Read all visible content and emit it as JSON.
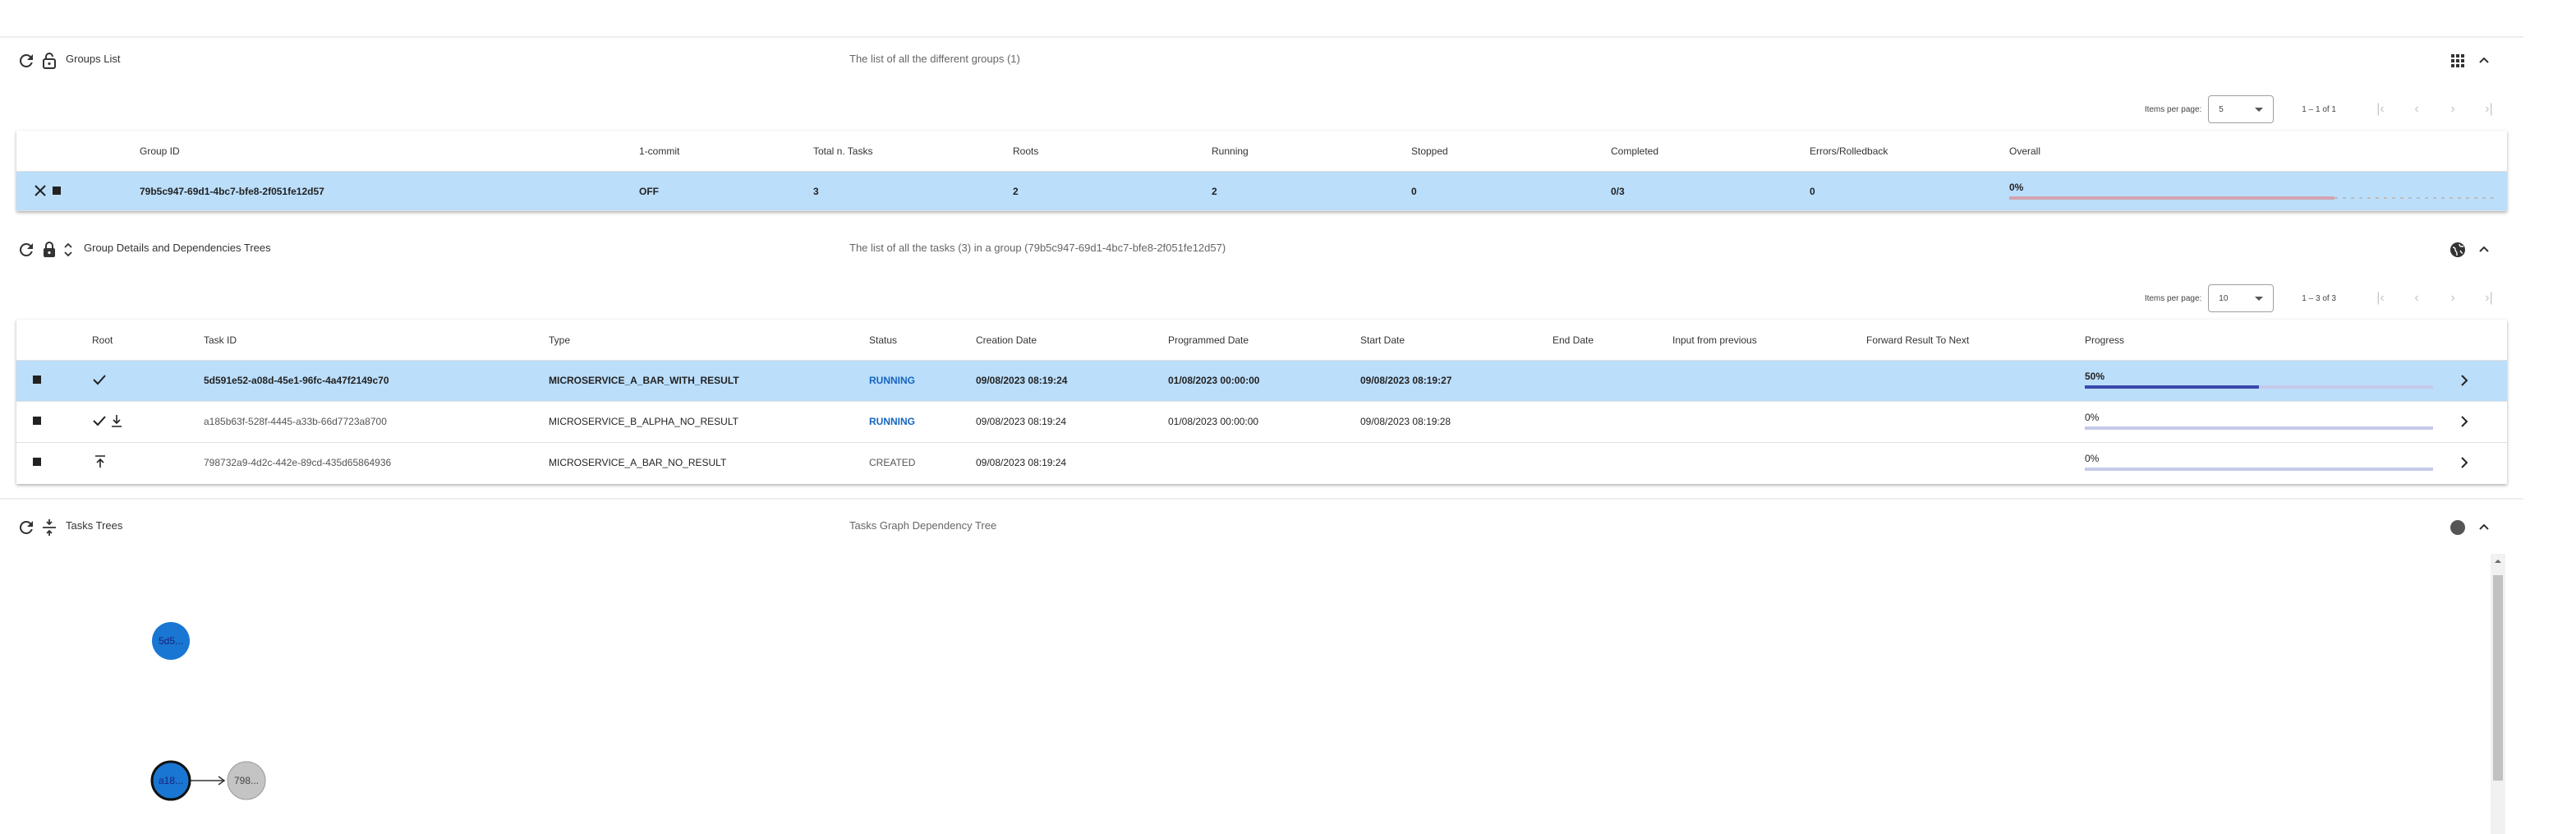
{
  "groups_panel": {
    "title": "Groups List",
    "description": "The list of all the different groups (1)",
    "items_per_page_label": "Items per page:",
    "items_per_page": "5",
    "range": "1 – 1 of 1",
    "columns": [
      "Group ID",
      "1-commit",
      "Total n. Tasks",
      "Roots",
      "Running",
      "Stopped",
      "Completed",
      "Errors/Rolledback",
      "Overall"
    ],
    "row": {
      "group_id": "79b5c947-69d1-4bc7-bfe8-2f051fe12d57",
      "one_commit": "OFF",
      "total_tasks": "3",
      "roots": "2",
      "running": "2",
      "stopped": "0",
      "completed": "0/3",
      "errors": "0",
      "overall": "0%",
      "overall_progress": 0
    }
  },
  "details_panel": {
    "title": "Group Details and Dependencies Trees",
    "description": "The list of all the tasks (3) in a group (79b5c947-69d1-4bc7-bfe8-2f051fe12d57)",
    "items_per_page_label": "Items per page:",
    "items_per_page": "10",
    "range": "1 – 3 of 3",
    "columns": [
      "Root",
      "Task ID",
      "Type",
      "Status",
      "Creation Date",
      "Programmed Date",
      "Start Date",
      "End Date",
      "Input from previous",
      "Forward Result To Next",
      "Progress"
    ],
    "rows": [
      {
        "task_id": "5d591e52-a08d-45e1-96fc-4a47f2149c70",
        "type": "MICROSERVICE_A_BAR_WITH_RESULT",
        "status": "RUNNING",
        "creation": "09/08/2023 08:19:24",
        "programmed": "01/08/2023 00:00:00",
        "start": "09/08/2023 08:19:27",
        "end": "",
        "progress": "50%",
        "progress_value": 0.5
      },
      {
        "task_id": "a185b63f-528f-4445-a33b-66d7723a8700",
        "type": "MICROSERVICE_B_ALPHA_NO_RESULT",
        "status": "RUNNING",
        "creation": "09/08/2023 08:19:24",
        "programmed": "01/08/2023 00:00:00",
        "start": "09/08/2023 08:19:28",
        "end": "",
        "progress": "0%",
        "progress_value": 0
      },
      {
        "task_id": "798732a9-4d2c-442e-89cd-435d65864936",
        "type": "MICROSERVICE_A_BAR_NO_RESULT",
        "status": "CREATED",
        "creation": "09/08/2023 08:19:24",
        "programmed": "",
        "start": "",
        "end": "",
        "progress": "0%",
        "progress_value": 0
      }
    ]
  },
  "trees_panel": {
    "title": "Tasks Trees",
    "description": "Tasks Graph Dependency Tree",
    "nodes": [
      "5d5...",
      "a18...",
      "798..."
    ]
  },
  "colors": {
    "selected_row": "#bbdefb",
    "node_blue": "#1976d2",
    "node_grey": "#c4c4c4",
    "running_status": "#1565c0"
  }
}
